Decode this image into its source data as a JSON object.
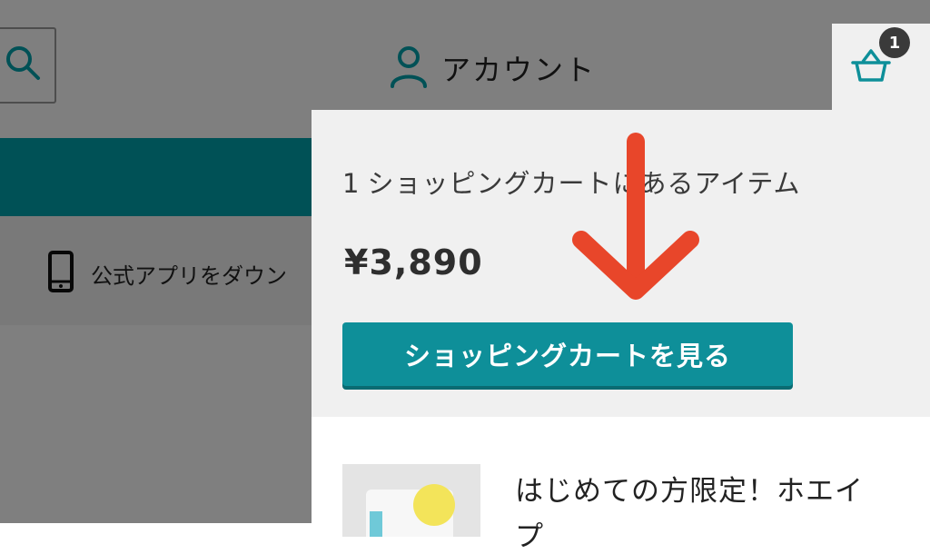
{
  "header": {
    "account_label": "アカウント"
  },
  "app_banner": {
    "label": "公式アプリをダウン"
  },
  "cart": {
    "badge_count": "1"
  },
  "cart_panel": {
    "item_count": "1",
    "item_count_text": "ショッピングカートにあるアイテム",
    "total": "¥3,890",
    "view_cart_button": "ショッピングカートを見る",
    "product_name_line1": "はじめての方限定！ホエイ",
    "product_name_line2": "プ"
  },
  "colors": {
    "teal": "#00a2ad",
    "button_teal": "#0e8f99",
    "arrow_red": "#e8462a",
    "badge": "#3a3a3a"
  },
  "icons": {
    "search": "search-icon",
    "account": "user-icon",
    "cart": "basket-icon",
    "phone": "smartphone-icon",
    "annotation": "down-arrow"
  }
}
